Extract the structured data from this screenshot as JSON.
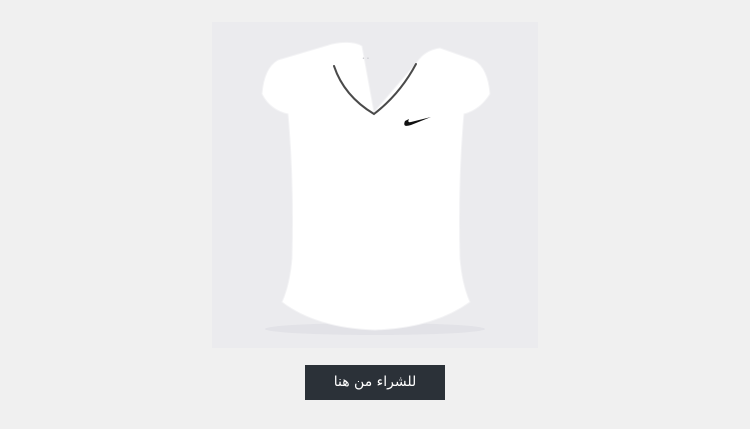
{
  "product": {
    "image_alt": "قميص Nike أبيض بياقة V",
    "brand_icon": "nike-swoosh-icon",
    "background_color": "#ebebee",
    "garment_color": "#ffffff"
  },
  "cta": {
    "label": "للشراء من هنا",
    "background_color": "#2b3138",
    "text_color": "#ffffff"
  }
}
